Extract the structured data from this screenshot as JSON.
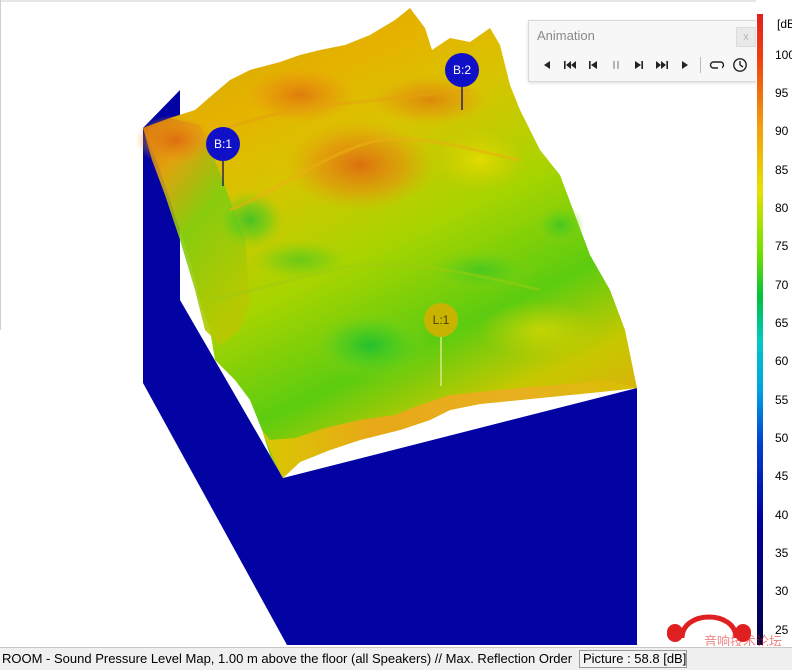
{
  "animation": {
    "title": "Animation",
    "close_label": "x",
    "controls": [
      {
        "name": "play-reverse-icon"
      },
      {
        "name": "skip-to-start-icon"
      },
      {
        "name": "step-back-icon"
      },
      {
        "name": "pause-icon"
      },
      {
        "name": "step-forward-icon"
      },
      {
        "name": "skip-to-end-icon"
      },
      {
        "name": "play-icon"
      },
      {
        "name": "loop-icon"
      },
      {
        "name": "clock-icon"
      }
    ]
  },
  "markers": [
    {
      "label": "B:1",
      "color": "#1010c8"
    },
    {
      "label": "B:2",
      "color": "#1010c8"
    },
    {
      "label": "L:1",
      "color": "#c8b400"
    }
  ],
  "legend": {
    "unit": "[dB]",
    "ticks": [
      "100",
      "95",
      "90",
      "85",
      "80",
      "75",
      "70",
      "65",
      "60",
      "55",
      "50",
      "45",
      "40",
      "35",
      "30",
      "25"
    ]
  },
  "status": {
    "text": "ROOM - Sound Pressure Level Map, 1.00 m above the floor (all Speakers) // Max. Reflection Order",
    "picture": "Picture : 58.8 [dB]"
  },
  "watermark": {
    "text": "音响技术论坛"
  },
  "colors": {
    "box_side": "#0303a3",
    "accent_red": "#e02020"
  }
}
